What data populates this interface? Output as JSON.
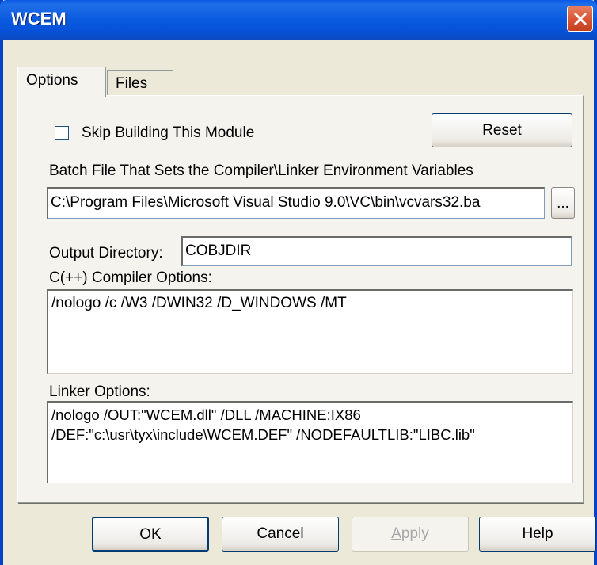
{
  "window": {
    "title": "WCEM"
  },
  "tabs": [
    {
      "label": "Options",
      "active": true
    },
    {
      "label": "Files",
      "active": false
    }
  ],
  "options": {
    "skip_build_label": "Skip Building This Module",
    "skip_build_checked": false,
    "reset_label_first": "R",
    "reset_label_rest": "eset",
    "batch_label": "Batch File That Sets the Compiler\\Linker Environment Variables",
    "batch_value": "C:\\Program Files\\Microsoft Visual Studio 9.0\\VC\\bin\\vcvars32.ba",
    "browse_label": "...",
    "output_dir_label": "Output Directory:",
    "output_dir_value": "COBJDIR",
    "compiler_label": "C(++) Compiler Options:",
    "compiler_value": "/nologo /c /W3 /DWIN32 /D_WINDOWS /MT",
    "linker_label": "Linker Options:",
    "linker_line1": "/nologo /OUT:\"WCEM.dll\" /DLL /MACHINE:IX86",
    "linker_line2": "/DEF:\"c:\\usr\\tyx\\include\\WCEM.DEF\" /NODEFAULTLIB:\"LIBC.lib\""
  },
  "buttons": {
    "ok": "OK",
    "cancel": "Cancel",
    "apply_first": "A",
    "apply_rest": "pply",
    "help": "Help"
  }
}
